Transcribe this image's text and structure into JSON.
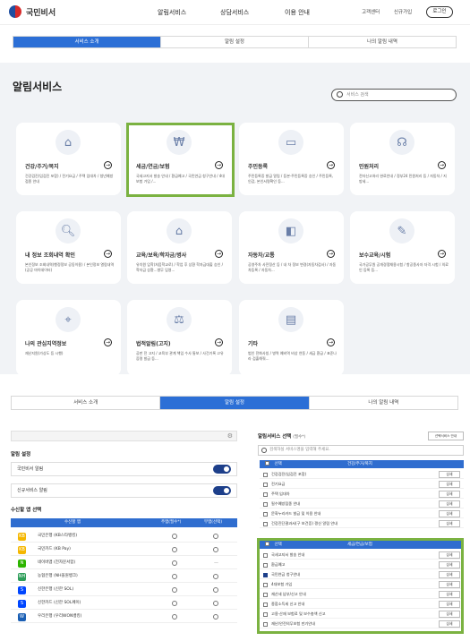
{
  "header": {
    "brand": "국민비서",
    "nav": [
      "알림서비스",
      "상담서비스",
      "이용 안내"
    ],
    "util": [
      "고객센터",
      "신규가입"
    ],
    "login": "로그인"
  },
  "tabs_top": [
    "서비스 소개",
    "알림 설정",
    "나의 알림 내역"
  ],
  "page_title": "알림서비스",
  "search_placeholder": "서비스 검색",
  "cards": [
    {
      "title": "건강/주거/복지",
      "icon": "house-heart-icon",
      "desc": "건강검진(임검진 포함) / 전기요금 / 주택 임대차 / 청년예방접종 안내"
    },
    {
      "title": "세금/연금/보험",
      "icon": "money-bag-icon",
      "desc": "국세고지서 발송 안내 / 환급예고 / 국민연금 청구안내 / 4대보험 가입 /..."
    },
    {
      "title": "주민등록",
      "icon": "id-card-icon",
      "desc": "주민등록증 발급 알림 / 등본·주민등록증 승인 / 주민등록, 인감, 본인서명확인 등..."
    },
    {
      "title": "민원처리",
      "icon": "headset-icon",
      "desc": "전자신고처리 완료안내 / 정부24 민원처리 등 / 자동차 / 지방세..."
    },
    {
      "title": "내 정보 조회내역 확인",
      "icon": "document-search-icon",
      "desc": "본인정보 조회내역(행정정보 공동이용) / 본인정보 열람내역(공공 마이데이터)"
    },
    {
      "title": "교육/보육/학자금/병사",
      "icon": "school-icon",
      "desc": "유치원 입학(처음학교로) / 학업 후 상환 학자금대출 승인 / 학자금 상환...병무 입영..."
    },
    {
      "title": "자동차/교통",
      "icon": "car-icon",
      "desc": "공영주차 사전정산 등 / 내 차 정보 변경(자동차검사) / 자동차등록 / 자동차..."
    },
    {
      "title": "보수교육/시험",
      "icon": "certificate-icon",
      "desc": "국가공무원 공개경쟁채용시험 / 항공종사자 자격 시험 / 의료인 등록 등..."
    },
    {
      "title": "나의 관심지역정보",
      "icon": "map-pin-icon",
      "desc": "재난지원(가상도 등 시행)"
    },
    {
      "title": "법적알림(고지)",
      "icon": "gavel-icon",
      "desc": "공판 전 고지 / 교육부 관계 책임 수사 통보 / 사건기록 고유 증명 발급 등..."
    },
    {
      "title": "기타",
      "icon": "inbox-icon",
      "desc": "범인 전화사칭 / 병역 예비역 비상 연동 / 세금 환급 / 표준나라 검출해줘..."
    }
  ],
  "tabs_bottom": [
    "서비스 소개",
    "알림 설정",
    "나의 알림 내역"
  ],
  "settings": {
    "section_title": "알림 설정",
    "rows": [
      "국민비서 알림",
      "신규서비스 알림"
    ],
    "apps_title": "수신할 앱 선택",
    "col_app": "수신할 앱",
    "col_main": "주앱(필수*)",
    "col_sub": "부앱(선택)",
    "apps": [
      {
        "name": "국민은행 (KB스타뱅킹)",
        "color": "#f5b700",
        "mark": "KB"
      },
      {
        "name": "국민카드 (KB Pay)",
        "color": "#f5b700",
        "mark": "KB"
      },
      {
        "name": "네이버앱 (전자문서함)",
        "color": "#2db400",
        "mark": "N"
      },
      {
        "name": "농협은행 (NH올원뱅크)",
        "color": "#2e9e5a",
        "mark": "NH"
      },
      {
        "name": "신한은행 (신한 SOL)",
        "color": "#0046ff",
        "mark": "S"
      },
      {
        "name": "신한카드 (신한 SOL페이)",
        "color": "#0046ff",
        "mark": "S"
      },
      {
        "name": "우리은행 (우리WON뱅킹)",
        "color": "#1a5fb4",
        "mark": "W"
      }
    ]
  },
  "select": {
    "title": "알림서비스 선택",
    "required": "(필수*)",
    "search_placeholder": "검색하실 서비스명을 입력해 주세요.",
    "link": "선택서비스 안내",
    "col_select": "선택",
    "group1": "건강/주거/복지",
    "group1_items": [
      "건강검진(임검진 포함)",
      "전기요금",
      "주택 임대차",
      "필수예방접종 안내",
      "문화누리카드 발급 및 이용 안내",
      "건강진단결과서(구 보건증) 갱신 알림 안내"
    ],
    "group2": "세금/연금/보험",
    "group2_items": [
      "국세고지서 발송 안내",
      "환급예고",
      "국민연금 청구안내",
      "4대보험 가입",
      "재산세 납부/신고 안내",
      "종합소득세 신고 안내",
      "고용·산재 보험료 및 보수총액 신고",
      "재난/안전의무보험 만기안내"
    ],
    "detail": "상세"
  }
}
